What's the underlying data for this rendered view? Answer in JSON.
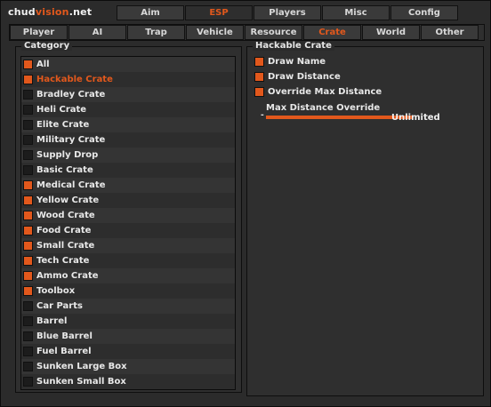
{
  "brand": {
    "part1": "chud",
    "part2": "vision",
    "part3": ".net"
  },
  "top_tabs": [
    {
      "label": "Aim",
      "active": false
    },
    {
      "label": "ESP",
      "active": true
    },
    {
      "label": "Players",
      "active": false
    },
    {
      "label": "Misc",
      "active": false
    },
    {
      "label": "Config",
      "active": false
    }
  ],
  "sub_tabs": [
    {
      "label": "Player",
      "active": false
    },
    {
      "label": "AI",
      "active": false
    },
    {
      "label": "Trap",
      "active": false
    },
    {
      "label": "Vehicle",
      "active": false
    },
    {
      "label": "Resource",
      "active": false
    },
    {
      "label": "Crate",
      "active": true
    },
    {
      "label": "World",
      "active": false
    },
    {
      "label": "Other",
      "active": false
    }
  ],
  "category": {
    "title": "Category",
    "items": [
      {
        "label": "All",
        "checked": true,
        "selected": false
      },
      {
        "label": "Hackable Crate",
        "checked": true,
        "selected": true
      },
      {
        "label": "Bradley Crate",
        "checked": false,
        "selected": false
      },
      {
        "label": "Heli Crate",
        "checked": false,
        "selected": false
      },
      {
        "label": "Elite Crate",
        "checked": false,
        "selected": false
      },
      {
        "label": "Military Crate",
        "checked": false,
        "selected": false
      },
      {
        "label": "Supply Drop",
        "checked": false,
        "selected": false
      },
      {
        "label": "Basic Crate",
        "checked": false,
        "selected": false
      },
      {
        "label": "Medical Crate",
        "checked": true,
        "selected": false
      },
      {
        "label": "Yellow Crate",
        "checked": true,
        "selected": false
      },
      {
        "label": "Wood Crate",
        "checked": true,
        "selected": false
      },
      {
        "label": "Food Crate",
        "checked": true,
        "selected": false
      },
      {
        "label": "Small Crate",
        "checked": true,
        "selected": false
      },
      {
        "label": "Tech Crate",
        "checked": true,
        "selected": false
      },
      {
        "label": "Ammo Crate",
        "checked": true,
        "selected": false
      },
      {
        "label": "Toolbox",
        "checked": true,
        "selected": false
      },
      {
        "label": "Car Parts",
        "checked": false,
        "selected": false
      },
      {
        "label": "Barrel",
        "checked": false,
        "selected": false
      },
      {
        "label": "Blue Barrel",
        "checked": false,
        "selected": false
      },
      {
        "label": "Fuel Barrel",
        "checked": false,
        "selected": false
      },
      {
        "label": "Sunken Large Box",
        "checked": false,
        "selected": false
      },
      {
        "label": "Sunken Small Box",
        "checked": false,
        "selected": false
      }
    ]
  },
  "detail": {
    "title": "Hackable Crate",
    "options": [
      {
        "label": "Draw Name",
        "checked": true
      },
      {
        "label": "Draw Distance",
        "checked": true
      },
      {
        "label": "Override Max Distance",
        "checked": true
      }
    ],
    "slider": {
      "label": "Max Distance Override",
      "minus": "-",
      "value_text": "Unlimited",
      "fill_fraction": 1.0
    }
  },
  "colors": {
    "accent": "#e2581c",
    "background": "#2b2b2b"
  }
}
